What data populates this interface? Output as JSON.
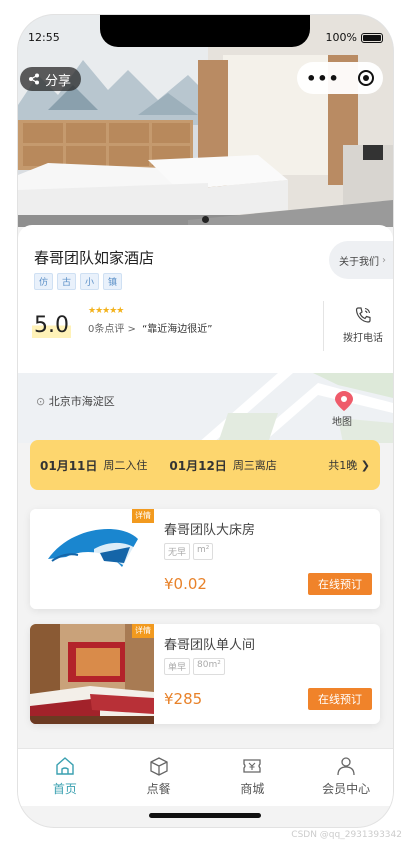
{
  "status_bar": {
    "time": "12:55",
    "battery": "100%"
  },
  "top_actions": {
    "share_label": "分享"
  },
  "hotel": {
    "name": "春哥团队如家酒店",
    "tags": [
      "仿",
      "古",
      "小",
      "镇"
    ],
    "about_label": "关于我们",
    "score": "5.0",
    "stars": "★★★★★",
    "reviews_text": "0条点评 >",
    "quote": "“靠近海边很近”",
    "call_label": "拨打电话",
    "address": "北京市海淀区",
    "map_label": "地图"
  },
  "dates": {
    "checkin_date": "01月11日",
    "checkin_label": "周二入住",
    "checkout_date": "01月12日",
    "checkout_label": "周三离店",
    "nights": "共1晚 ❯"
  },
  "rooms": [
    {
      "name": "春哥团队大床房",
      "tags": [
        "无早",
        "m²"
      ],
      "price": "¥0.02",
      "book_label": "在线预订",
      "detail_label": "详情"
    },
    {
      "name": "春哥团队单人间",
      "tags": [
        "单早",
        "80m²"
      ],
      "price": "¥285",
      "book_label": "在线预订",
      "detail_label": "详情"
    }
  ],
  "tabbar": {
    "items": [
      {
        "label": "首页",
        "icon": "home-icon"
      },
      {
        "label": "点餐",
        "icon": "box-icon"
      },
      {
        "label": "商城",
        "icon": "ticket-icon"
      },
      {
        "label": "会员中心",
        "icon": "user-icon"
      }
    ]
  },
  "colors": {
    "accent": "#3aa0b0",
    "date_bar": "#fdd66e",
    "book": "#f0832a",
    "price": "#e8822a"
  },
  "watermark": "CSDN @qq_2931393342"
}
